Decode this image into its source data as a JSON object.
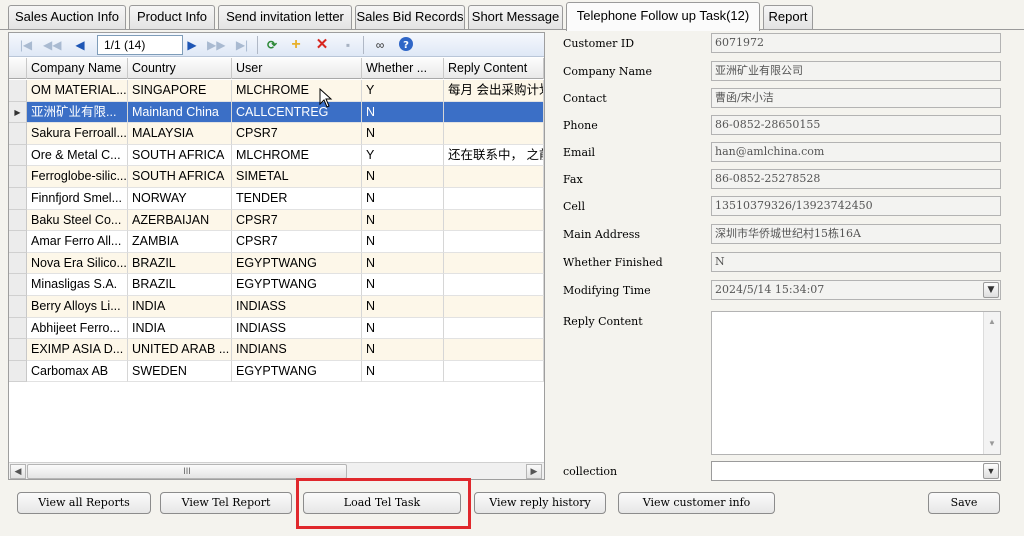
{
  "tabs": [
    {
      "label": "Sales Auction Info"
    },
    {
      "label": "Product Info"
    },
    {
      "label": "Send invitation letter"
    },
    {
      "label": "Sales Bid Records"
    },
    {
      "label": "Short Message"
    },
    {
      "label": "Telephone Follow up Task(12)"
    },
    {
      "label": "Report"
    }
  ],
  "toolbar": {
    "page_indicator": "1/1 (14)",
    "icons": [
      "first-page-icon",
      "prev-page-icon",
      "prev-icon",
      "next-icon",
      "next-page-icon",
      "last-page-icon",
      "refresh-icon",
      "add-icon",
      "delete-icon",
      "save-icon",
      "binoculars-icon",
      "help-icon"
    ]
  },
  "grid": {
    "columns": [
      "Company Name",
      "Country",
      "User",
      "Whether ...",
      "Reply Content"
    ],
    "rows": [
      {
        "company": "OM MATERIAL...",
        "country": "SINGAPORE",
        "user": "MLCHROME",
        "whether": "Y",
        "reply": "每月 会出采购计划"
      },
      {
        "company": "亚洲矿业有限...",
        "country": "Mainland China",
        "user": "CALLCENTREG",
        "whether": "N",
        "reply": ""
      },
      {
        "company": "Sakura Ferroall...",
        "country": "MALAYSIA",
        "user": "CPSR7",
        "whether": "N",
        "reply": ""
      },
      {
        "company": "Ore & Metal C...",
        "country": "SOUTH AFRICA",
        "user": "MLCHROME",
        "whether": "Y",
        "reply": "还在联系中， 之前"
      },
      {
        "company": "Ferroglobe-silic...",
        "country": "SOUTH AFRICA",
        "user": "SIMETAL",
        "whether": "N",
        "reply": ""
      },
      {
        "company": "Finnfjord  Smel...",
        "country": "NORWAY",
        "user": "TENDER",
        "whether": "N",
        "reply": ""
      },
      {
        "company": "Baku Steel Co...",
        "country": "AZERBAIJAN",
        "user": "CPSR7",
        "whether": "N",
        "reply": ""
      },
      {
        "company": "Amar Ferro All...",
        "country": "ZAMBIA",
        "user": "CPSR7",
        "whether": "N",
        "reply": ""
      },
      {
        "company": "Nova Era Silico...",
        "country": "BRAZIL",
        "user": "EGYPTWANG",
        "whether": "N",
        "reply": ""
      },
      {
        "company": "Minasligas S.A.",
        "country": "BRAZIL",
        "user": "EGYPTWANG",
        "whether": "N",
        "reply": ""
      },
      {
        "company": "Berry Alloys Li...",
        "country": "INDIA",
        "user": "INDIASS",
        "whether": "N",
        "reply": ""
      },
      {
        "company": "Abhijeet Ferro...",
        "country": "INDIA",
        "user": "INDIASS",
        "whether": "N",
        "reply": ""
      },
      {
        "company": "EXIMP ASIA D...",
        "country": "UNITED ARAB ...",
        "user": "INDIANS",
        "whether": "N",
        "reply": ""
      },
      {
        "company": "Carbomax AB",
        "country": "SWEDEN",
        "user": "EGYPTWANG",
        "whether": "N",
        "reply": ""
      }
    ],
    "selected_row": 1,
    "scroll_grip": "III"
  },
  "form": {
    "customer_id": {
      "label": "Customer ID",
      "value": "6071972"
    },
    "company_name": {
      "label": "Company Name",
      "value": "亚洲矿业有限公司"
    },
    "contact": {
      "label": "Contact",
      "value": "曹函/宋小洁"
    },
    "phone": {
      "label": "Phone",
      "value": "86-0852-28650155"
    },
    "email": {
      "label": "Email",
      "value": "han@amlchina.com"
    },
    "fax": {
      "label": "Fax",
      "value": "86-0852-25278528"
    },
    "cell": {
      "label": "Cell",
      "value": "13510379326/13923742450"
    },
    "main_address": {
      "label": "Main Address",
      "value": "深圳市华侨城世纪村15栋16A"
    },
    "whether_finished": {
      "label": "Whether Finished",
      "value": "N"
    },
    "modifying_time": {
      "label": "Modifying Time",
      "value": "2024/5/14 15:34:07"
    },
    "reply_content": {
      "label": "Reply Content",
      "value": ""
    },
    "collection": {
      "label": "collection",
      "value": ""
    }
  },
  "buttons": {
    "view_all_reports": "View all Reports",
    "view_tel_report": "View Tel Report",
    "load_tel_task": "Load Tel Task",
    "view_reply_history": "View reply history",
    "view_customer_info": "View customer info",
    "save": "Save"
  },
  "colors": {
    "selection": "#3b6fc6",
    "highlight_box": "#e0282c",
    "alt_row": "#fdf7e9"
  }
}
